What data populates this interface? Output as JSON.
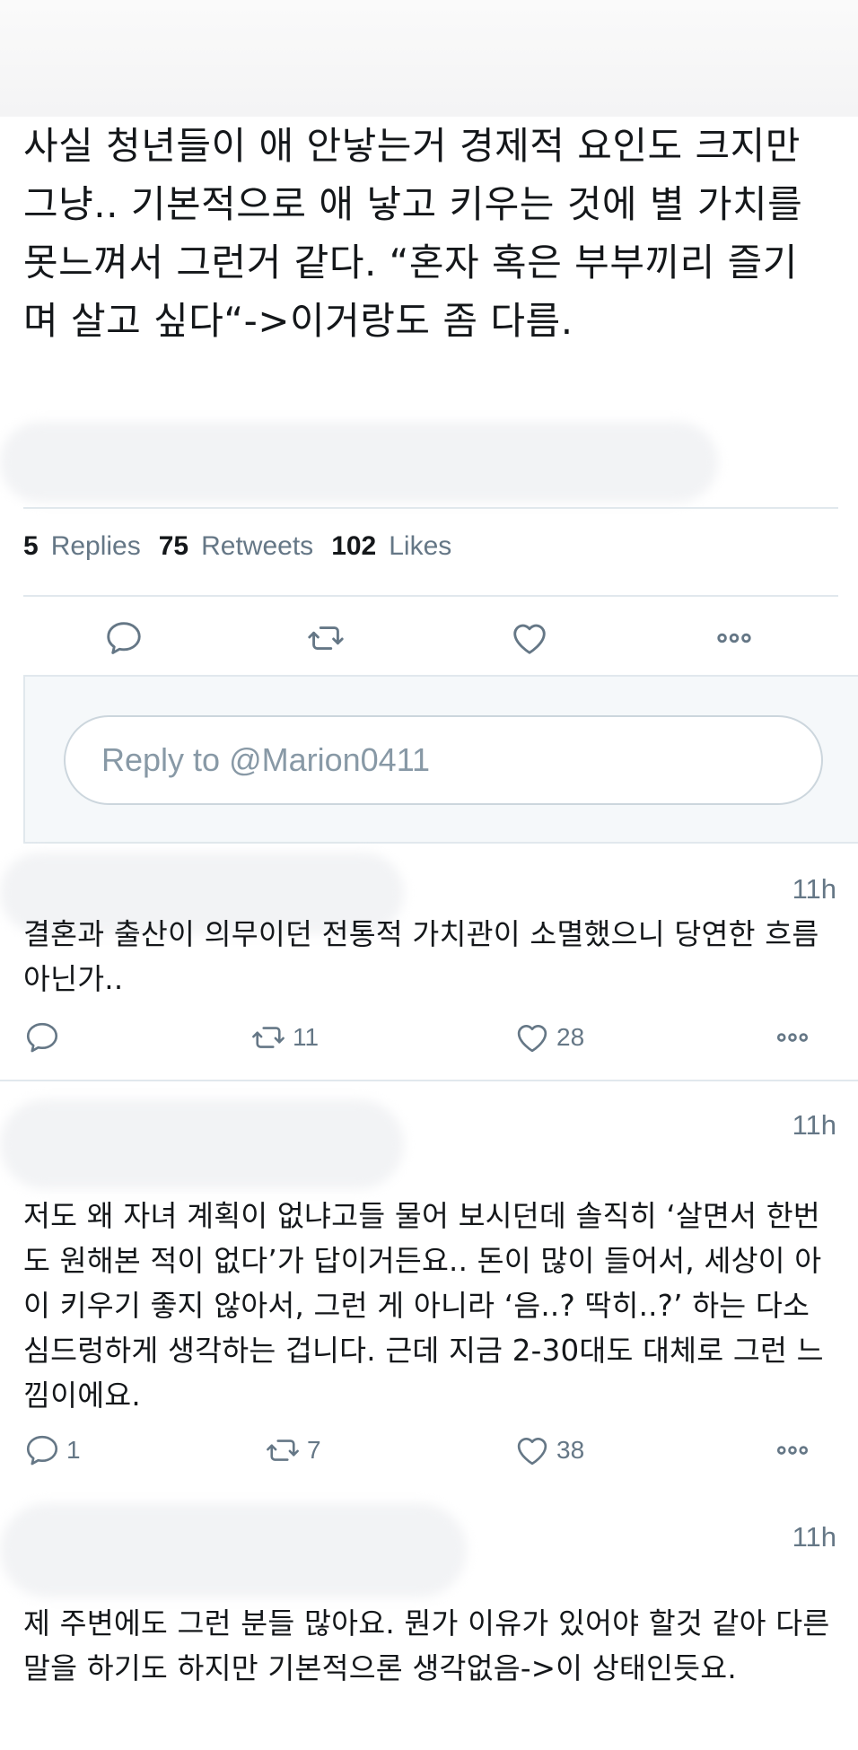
{
  "tweet": {
    "text": "사실 청년들이 애 안낳는거 경제적 요인도 크지만 그냥.. 기본적으로 애 낳고 키우는 것에 별 가치를 못느껴서 그런거 같다. “혼자 혹은 부부끼리 즐기며 살고 싶다“->이거랑도 좀 다름.",
    "stats": {
      "replies_count": "5",
      "replies_label": "Replies",
      "retweets_count": "75",
      "retweets_label": "Retweets",
      "likes_count": "102",
      "likes_label": "Likes"
    }
  },
  "reply_box": {
    "placeholder": "Reply to @Marion0411"
  },
  "replies": [
    {
      "time": "11h",
      "text": "결혼과 출산이 의무이던 전통적 가치관이 소멸했으니 당연한 흐름 아닌가..",
      "reply_count": "",
      "retweet_count": "11",
      "like_count": "28"
    },
    {
      "time": "11h",
      "text": "저도 왜 자녀 계획이 없냐고들 물어 보시던데 솔직히 ‘살면서 한번도 원해본 적이 없다’가 답이거든요.. 돈이 많이 들어서, 세상이 아이 키우기 좋지 않아서, 그런 게 아니라 ‘음..? 딱히..?’ 하는 다소 심드렁하게 생각하는 겁니다. 근데 지금 2-30대도 대체로 그런 느낌이에요.",
      "reply_count": "1",
      "retweet_count": "7",
      "like_count": "38"
    },
    {
      "time": "11h",
      "text": "제 주변에도 그런 분들 많아요. 뭔가 이유가 있어야 할것 같아 다른 말을 하기도 하지만 기본적으론 생각없음->이 상태인듯요.",
      "reply_count": "",
      "retweet_count": "",
      "like_count": ""
    }
  ],
  "icons": {
    "reply": "speech-bubble-icon",
    "retweet": "retweet-arrows-icon",
    "like": "heart-icon",
    "more": "three-dots-icon"
  },
  "colors": {
    "text": "#14171a",
    "secondary": "#657786",
    "border": "#e1e8ed",
    "reply_bg": "#f5f8fa"
  }
}
